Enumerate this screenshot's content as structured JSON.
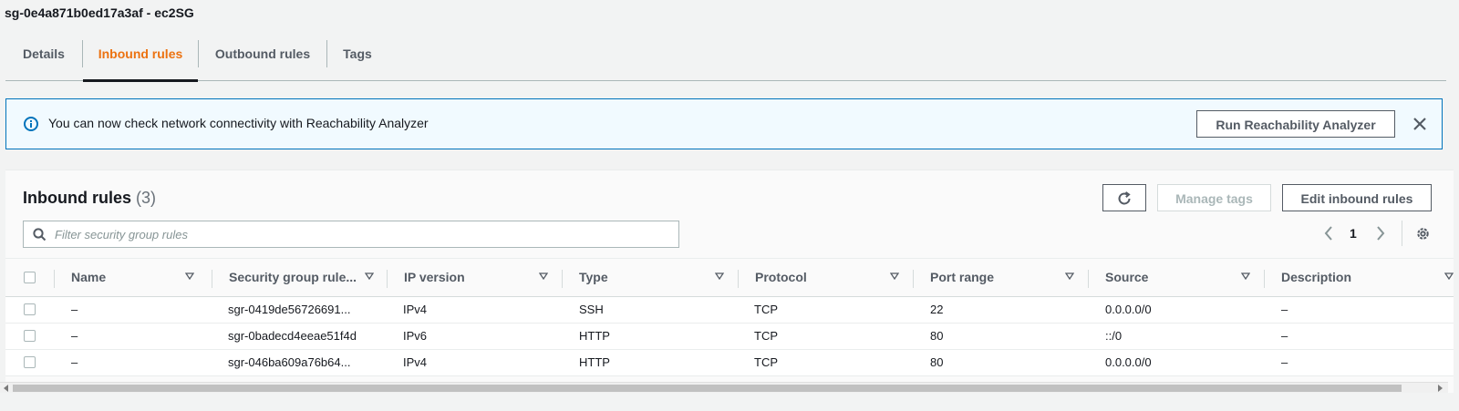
{
  "security_group": {
    "title": "sg-0e4a871b0ed17a3af - ec2SG"
  },
  "tabs": [
    {
      "label": "Details"
    },
    {
      "label": "Inbound rules"
    },
    {
      "label": "Outbound rules"
    },
    {
      "label": "Tags"
    }
  ],
  "active_tab": "Inbound rules",
  "alert": {
    "icon": "info-icon",
    "message": "You can now check network connectivity with Reachability Analyzer",
    "button_label": "Run Reachability Analyzer",
    "close_icon": "close-icon"
  },
  "panel": {
    "title": "Inbound rules",
    "count": "(3)",
    "refresh_icon": "refresh-icon",
    "manage_tags_label": "Manage tags",
    "edit_label": "Edit inbound rules",
    "filter_placeholder": "Filter security group rules",
    "page": "1"
  },
  "columns": [
    {
      "label": "Name"
    },
    {
      "label": "Security group rule..."
    },
    {
      "label": "IP version"
    },
    {
      "label": "Type"
    },
    {
      "label": "Protocol"
    },
    {
      "label": "Port range"
    },
    {
      "label": "Source"
    },
    {
      "label": "Description"
    }
  ],
  "rows": [
    {
      "name": "–",
      "rule_id": "sgr-0419de56726691...",
      "ip_version": "IPv4",
      "type": "SSH",
      "protocol": "TCP",
      "port_range": "22",
      "source": "0.0.0.0/0",
      "description": "–"
    },
    {
      "name": "–",
      "rule_id": "sgr-0badecd4eeae51f4d",
      "ip_version": "IPv6",
      "type": "HTTP",
      "protocol": "TCP",
      "port_range": "80",
      "source": "::/0",
      "description": "–"
    },
    {
      "name": "–",
      "rule_id": "sgr-046ba609a76b64...",
      "ip_version": "IPv4",
      "type": "HTTP",
      "protocol": "TCP",
      "port_range": "80",
      "source": "0.0.0.0/0",
      "description": "–"
    }
  ],
  "colors": {
    "accent": "#ec7211",
    "info_border": "#0073bb",
    "info_bg": "#f1faff",
    "text": "#16191f"
  }
}
